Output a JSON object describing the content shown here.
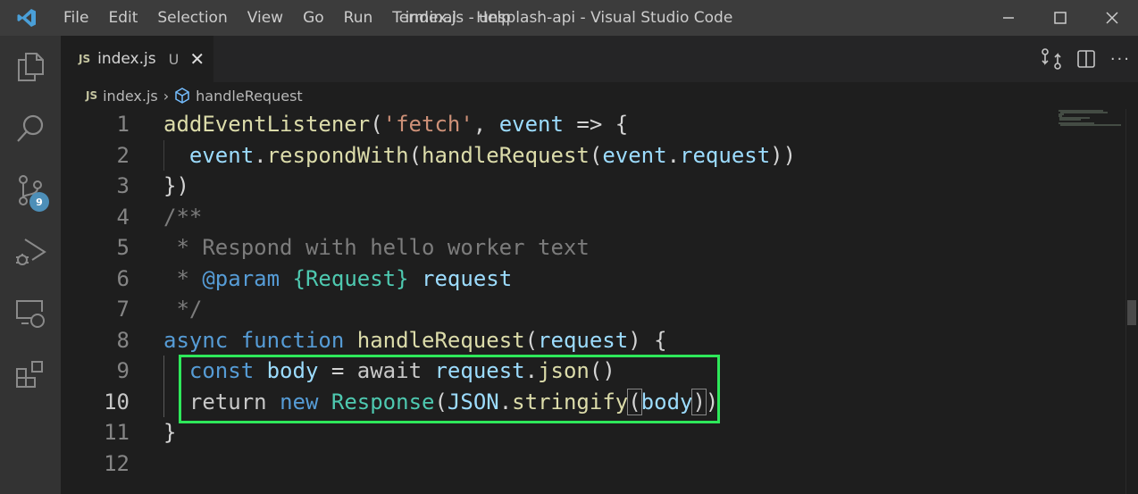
{
  "window": {
    "title": "index.js - unsplash-api - Visual Studio Code"
  },
  "menu": [
    "File",
    "Edit",
    "Selection",
    "View",
    "Go",
    "Run",
    "Terminal",
    "Help"
  ],
  "activity": {
    "scm_badge": "9"
  },
  "tab": {
    "icon": "JS",
    "name": "index.js",
    "status": "U"
  },
  "breadcrumb": {
    "icon": "JS",
    "file": "index.js",
    "symbol": "handleRequest"
  },
  "colors": {
    "keyword": "#569cd6",
    "func": "#dcdcaa",
    "var": "#9cdcfe",
    "type": "#4ec9b0",
    "string": "#ce9178",
    "comment": "#7c7c7c",
    "plain": "#d4d4d4",
    "control": "#c8c8c8",
    "highlight": "#2ee85a"
  },
  "current_line": 10,
  "lines": [
    {
      "n": "1",
      "tokens": [
        [
          "func",
          "addEventListener"
        ],
        [
          "plain",
          "("
        ],
        [
          "string",
          "'fetch'"
        ],
        [
          "plain",
          ", "
        ],
        [
          "var",
          "event"
        ],
        [
          "plain",
          " => {"
        ]
      ]
    },
    {
      "n": "2",
      "tokens": [
        [
          "plain",
          "  "
        ],
        [
          "var",
          "event"
        ],
        [
          "plain",
          "."
        ],
        [
          "func",
          "respondWith"
        ],
        [
          "plain",
          "("
        ],
        [
          "func",
          "handleRequest"
        ],
        [
          "plain",
          "("
        ],
        [
          "var",
          "event"
        ],
        [
          "plain",
          "."
        ],
        [
          "var",
          "request"
        ],
        [
          "plain",
          "))"
        ]
      ]
    },
    {
      "n": "3",
      "tokens": [
        [
          "plain",
          "})"
        ]
      ]
    },
    {
      "n": "4",
      "tokens": [
        [
          "comment",
          "/**"
        ]
      ]
    },
    {
      "n": "5",
      "tokens": [
        [
          "comment",
          " * Respond with hello worker text"
        ]
      ]
    },
    {
      "n": "6",
      "tokens": [
        [
          "comment",
          " * "
        ],
        [
          "keyword",
          "@param"
        ],
        [
          "comment",
          " "
        ],
        [
          "type",
          "{Request}"
        ],
        [
          "comment",
          " "
        ],
        [
          "var",
          "request"
        ]
      ]
    },
    {
      "n": "7",
      "tokens": [
        [
          "comment",
          " */"
        ]
      ]
    },
    {
      "n": "8",
      "tokens": [
        [
          "keyword",
          "async"
        ],
        [
          "plain",
          " "
        ],
        [
          "keyword",
          "function"
        ],
        [
          "plain",
          " "
        ],
        [
          "func",
          "handleRequest"
        ],
        [
          "plain",
          "("
        ],
        [
          "var",
          "request"
        ],
        [
          "plain",
          ") {"
        ]
      ]
    },
    {
      "n": "9",
      "tokens": [
        [
          "plain",
          "  "
        ],
        [
          "keyword",
          "const"
        ],
        [
          "plain",
          " "
        ],
        [
          "var",
          "body"
        ],
        [
          "plain",
          " = "
        ],
        [
          "control",
          "await"
        ],
        [
          "plain",
          " "
        ],
        [
          "var",
          "request"
        ],
        [
          "plain",
          "."
        ],
        [
          "func",
          "json"
        ],
        [
          "plain",
          "()"
        ]
      ]
    },
    {
      "n": "10",
      "tokens": [
        [
          "plain",
          "  "
        ],
        [
          "control",
          "return"
        ],
        [
          "plain",
          " "
        ],
        [
          "keyword",
          "new"
        ],
        [
          "plain",
          " "
        ],
        [
          "type",
          "Response"
        ],
        [
          "plain",
          "("
        ],
        [
          "var",
          "JSON"
        ],
        [
          "plain",
          "."
        ],
        [
          "func",
          "stringify"
        ],
        [
          "bracket",
          "("
        ],
        [
          "var",
          "body"
        ],
        [
          "bracket",
          ")"
        ],
        [
          "plain",
          ")"
        ]
      ]
    },
    {
      "n": "11",
      "tokens": [
        [
          "plain",
          "}"
        ]
      ]
    },
    {
      "n": "12",
      "tokens": []
    }
  ]
}
